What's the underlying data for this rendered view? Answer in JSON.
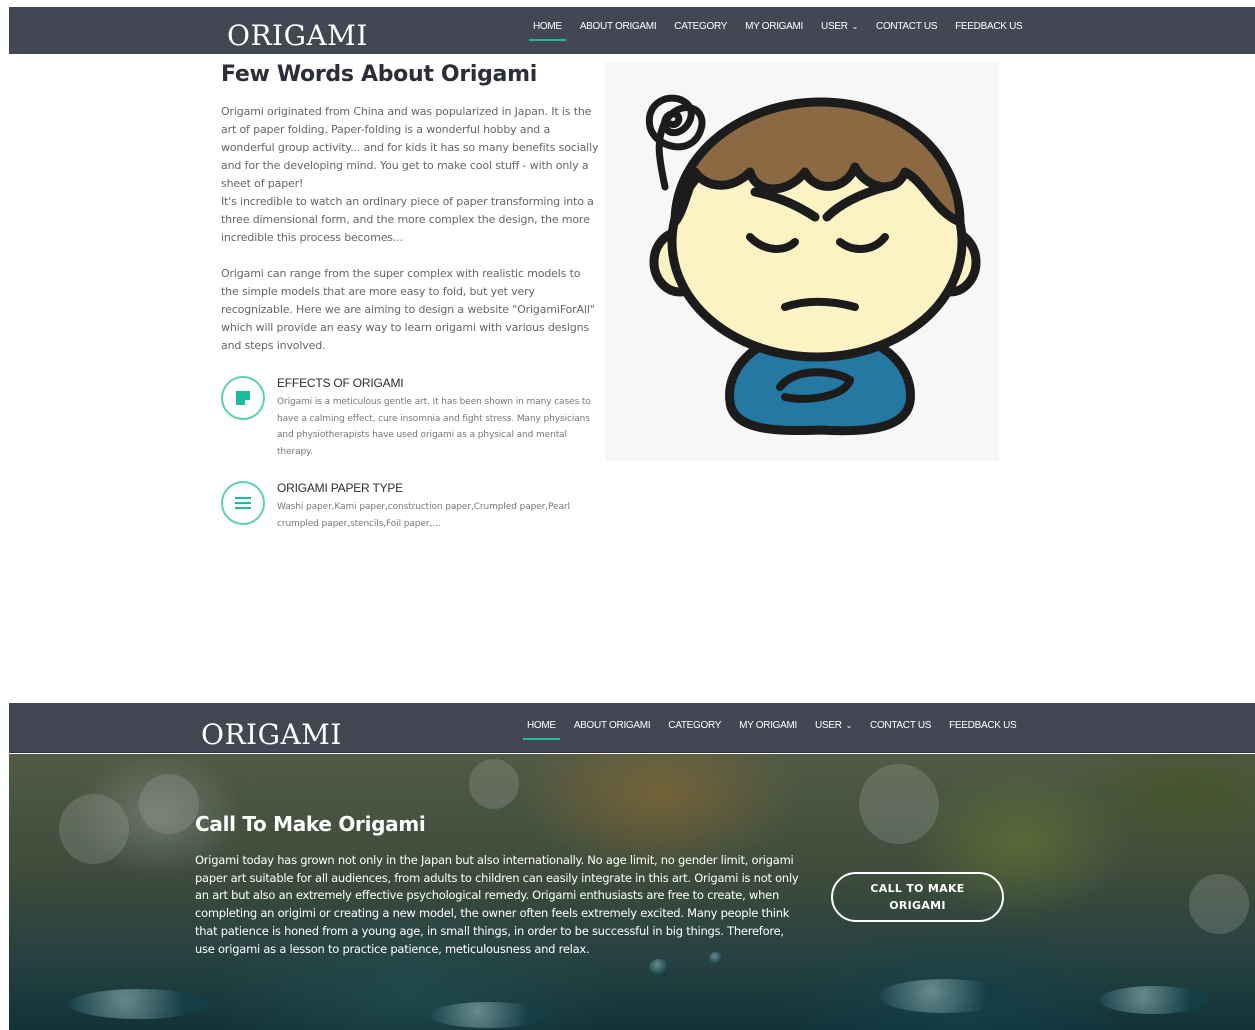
{
  "brand": {
    "logo": "ORIGAMI",
    "accent_color": "#1abc9c",
    "nav_background": "#434753"
  },
  "nav": {
    "items": [
      {
        "label": "HOME",
        "active": true
      },
      {
        "label": "ABOUT ORIGAMI"
      },
      {
        "label": "CATEGORY"
      },
      {
        "label": "MY ORIGAMI"
      },
      {
        "label": "USER",
        "dropdown": true
      },
      {
        "label": "CONTACT US"
      },
      {
        "label": "FEEDBACK US"
      }
    ]
  },
  "about": {
    "title": "Few Words About Origami",
    "paragraphs": [
      "Origami originated from China and was popularized in Japan. It is the art of paper folding. Paper-folding is a wonderful hobby and a wonderful group activity... and for kids it has so many benefits socially and for the developing mind. You get to make cool stuff - with only a sheet of paper!",
      "It's incredible to watch an ordinary piece of paper transforming into a three dimensional form, and the more complex the design, the more incredible this process becomes...",
      "Origami can range from the super complex with realistic models to the simple models that are more easy to fold, but yet very recognizable. Here we are aiming to design a website \"OrigamiForAll\" which will provide an easy way to learn origami with various designs and steps involved."
    ],
    "features": [
      {
        "icon": "sticky-note-icon",
        "title": "EFFECTS OF ORIGAMI",
        "text": "Origami is a meticulous gentle art. It has been shown in many cases to have a calming effect, cure insomnia and fight stress. Many physicians and physiotherapists have used origami as a physical and mental therapy."
      },
      {
        "icon": "list-icon",
        "title": "ORIGAMI PAPER TYPE",
        "text": "Washi paper,Kami paper,construction paper,Crumpled paper,Pearl crumpled paper,stencils,Foil paper,..."
      }
    ],
    "illustration": "confused-boy-illustration"
  },
  "cta": {
    "title": "Call To Make Origami",
    "text": "Origami today has grown not only in the Japan but also internationally. No age limit, no gender limit, origami paper art suitable for all audiences, from adults to children can easily integrate in this art. Origami is not only an art but also an extremely effective psychological remedy. Origami enthusiasts are free to create, when completing an origimi or creating a new model, the owner often feels extremely excited. Many people think that patience is honed from a young age, in small things, in order to be successful in big things. Therefore, use origami as a lesson to practice patience, meticulousness and relax.",
    "button_label": "CALL TO MAKE ORIGAMI"
  }
}
